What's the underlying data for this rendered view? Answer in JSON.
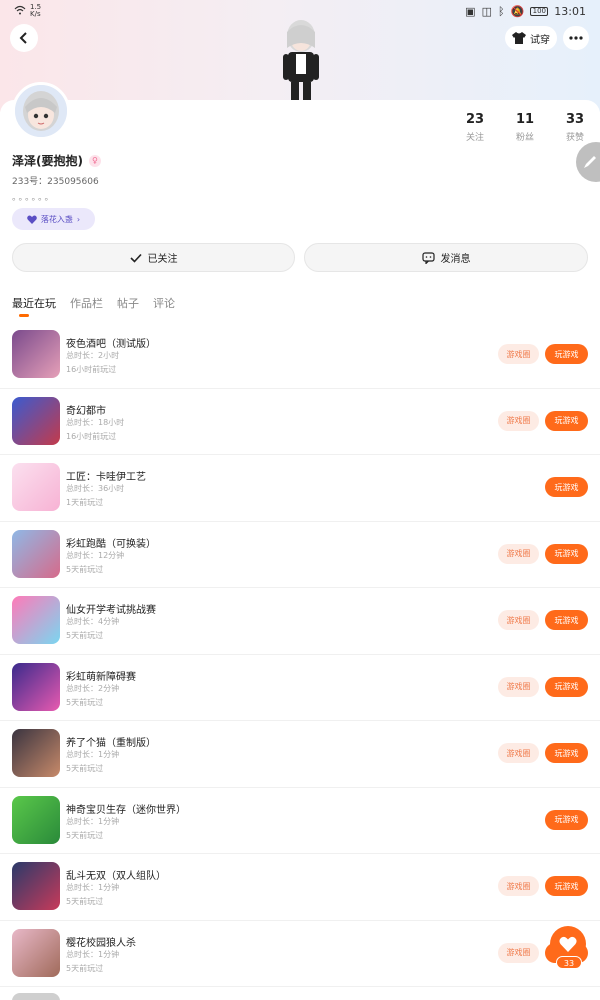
{
  "status_bar": {
    "left_net_top": "1.5",
    "left_net_bottom": "K/s",
    "battery": "100",
    "time": "13:01"
  },
  "header": {
    "dress_label": "试穿",
    "back_icon": "chevron-left-icon",
    "more_icon": "more-dots-icon"
  },
  "profile": {
    "username": "泽泽(要抱抱)",
    "gender_symbol": "♀",
    "uid": "233号：235095606",
    "bio": "。。。。。。",
    "tag_label": "落花入盏",
    "stats": [
      {
        "num": "23",
        "label": "关注"
      },
      {
        "num": "11",
        "label": "粉丝"
      },
      {
        "num": "33",
        "label": "获赞"
      }
    ]
  },
  "actions": {
    "follow_label": "已关注",
    "message_label": "发消息"
  },
  "tabs": [
    "最近在玩",
    "作品栏",
    "帖子",
    "评论"
  ],
  "buttons": {
    "circle_label": "游戏圈",
    "play_label": "玩游戏"
  },
  "games": [
    {
      "title": "夜色酒吧（测试版）",
      "duration": "总时长：2小时",
      "last": "16小时前玩过",
      "has_circle": true,
      "colors": [
        "#7a4a8c",
        "#e6a0b8"
      ]
    },
    {
      "title": "奇幻都市",
      "duration": "总时长：18小时",
      "last": "16小时前玩过",
      "has_circle": true,
      "colors": [
        "#3a5bd0",
        "#c43a4a"
      ]
    },
    {
      "title": "工匠：卡哇伊工艺",
      "duration": "总时长：36小时",
      "last": "1天前玩过",
      "has_circle": false,
      "colors": [
        "#fbe0ef",
        "#f7b2d4"
      ]
    },
    {
      "title": "彩虹跑酷（可换装）",
      "duration": "总时长：12分钟",
      "last": "5天前玩过",
      "has_circle": true,
      "colors": [
        "#8fb8e6",
        "#d66a8a"
      ]
    },
    {
      "title": "仙女开学考试挑战赛",
      "duration": "总时长：4分钟",
      "last": "5天前玩过",
      "has_circle": true,
      "colors": [
        "#ff7ab8",
        "#7ad6f0"
      ]
    },
    {
      "title": "彩虹萌新障碍赛",
      "duration": "总时长：2分钟",
      "last": "5天前玩过",
      "has_circle": true,
      "colors": [
        "#3a2a8c",
        "#e85ab0"
      ]
    },
    {
      "title": "养了个猫（重制版）",
      "duration": "总时长：1分钟",
      "last": "5天前玩过",
      "has_circle": true,
      "colors": [
        "#3a3440",
        "#c88a6a"
      ]
    },
    {
      "title": "神奇宝贝生存（迷你世界）",
      "duration": "总时长：1分钟",
      "last": "5天前玩过",
      "has_circle": false,
      "colors": [
        "#5ac84a",
        "#2a8a3a"
      ]
    },
    {
      "title": "乱斗无双（双人组队）",
      "duration": "总时长：1分钟",
      "last": "5天前玩过",
      "has_circle": true,
      "colors": [
        "#2a3a6a",
        "#c83a5a"
      ]
    },
    {
      "title": "樱花校园狼人杀",
      "duration": "总时长：1分钟",
      "last": "5天前玩过",
      "has_circle": true,
      "colors": [
        "#e8b8c8",
        "#a06a5a"
      ]
    }
  ],
  "fab": {
    "icon": "heart-icon",
    "count": "33"
  },
  "colors": {
    "accent": "#ff6a1a",
    "circle_bg": "#fdebe4",
    "tag_bg": "#ebe8fb"
  }
}
